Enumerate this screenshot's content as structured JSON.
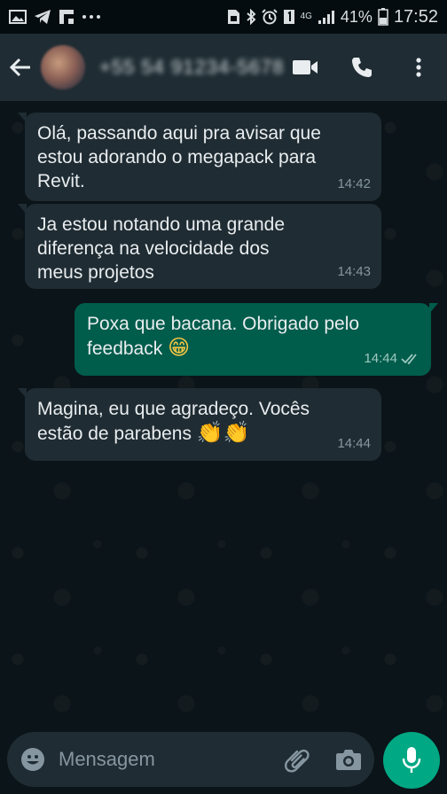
{
  "status_bar": {
    "left_icons": [
      "image-icon",
      "telegram-icon",
      "flipboard-icon",
      "more-icon"
    ],
    "right_icons": [
      "sim-icon",
      "bluetooth-icon",
      "alarm-icon",
      "sim1-icon",
      "4g-icon",
      "signal-icon"
    ],
    "network": "4G",
    "battery": "41%",
    "time": "17:52"
  },
  "header": {
    "contact_name": "+55 54 91234-5678",
    "icons": [
      "back-arrow-icon",
      "video-call-icon",
      "phone-icon",
      "more-vert-icon"
    ]
  },
  "messages": [
    {
      "direction": "in",
      "text": "Olá, passando aqui pra avisar que estou adorando o megapack para Revit.",
      "time": "14:42"
    },
    {
      "direction": "in",
      "text": "Ja estou notando uma grande diferença na velocidade dos meus projetos",
      "time": "14:43"
    },
    {
      "direction": "out",
      "text": "Poxa que bacana. Obrigado pelo feedback",
      "emoji": "😁",
      "time": "14:44",
      "status": "read"
    },
    {
      "direction": "in",
      "text": "Magina, eu que agradeço. Vocês estão de parabens",
      "emoji": "👏👏",
      "time": "14:44"
    }
  ],
  "input": {
    "placeholder": "Mensagem",
    "icons": [
      "emoji-icon",
      "attach-icon",
      "camera-icon",
      "mic-icon"
    ]
  },
  "colors": {
    "background": "#0b1418",
    "header": "#1f2c33",
    "incoming_bubble": "#1f2c33",
    "outgoing_bubble": "#005c4b",
    "accent": "#00a884"
  }
}
